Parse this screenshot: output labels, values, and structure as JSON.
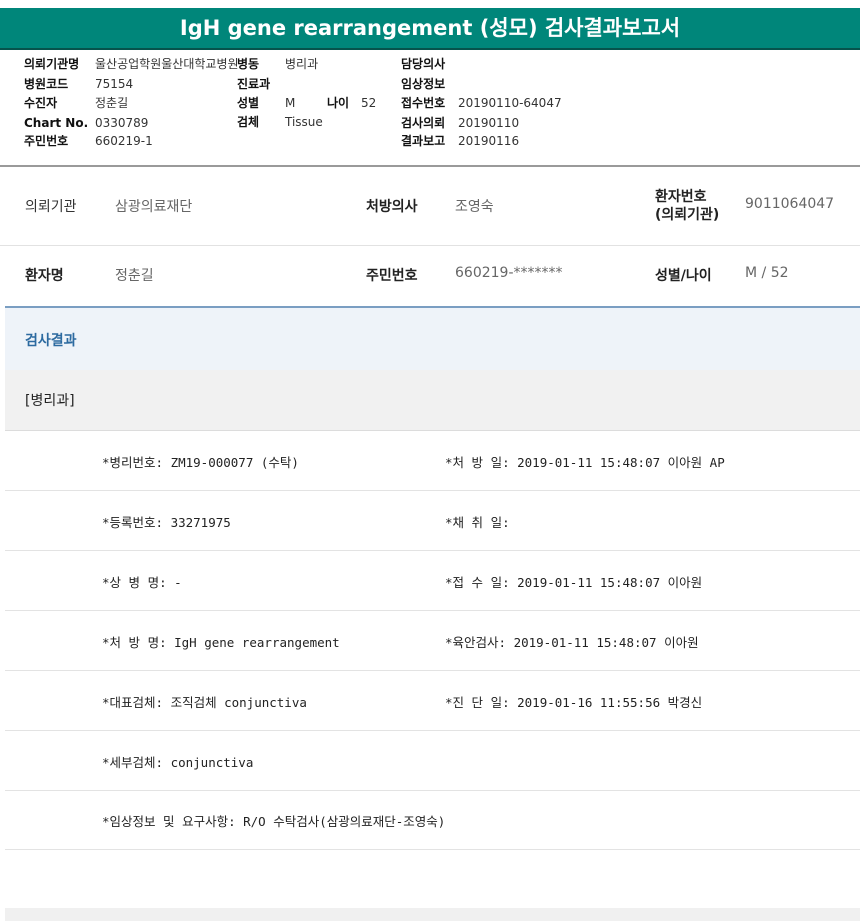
{
  "title": "IgH gene rearrangement (성모) 검사결과보고서",
  "header": {
    "col1": [
      {
        "label": "의뢰기관명",
        "value": "울산공업학원울산대학교병원"
      },
      {
        "label": "병원코드",
        "value": "75154"
      },
      {
        "label": "수진자",
        "value": "정춘길"
      },
      {
        "label": "Chart No.",
        "value": "0330789"
      },
      {
        "label": "주민번호",
        "value": "660219-1"
      }
    ],
    "col2": [
      {
        "label": "병동",
        "value": "병리과"
      },
      {
        "label": "진료과",
        "value": ""
      },
      {
        "label": "성별",
        "value": "M",
        "label2": "나이",
        "value2": "52"
      },
      {
        "label": "검체",
        "value": "Tissue"
      }
    ],
    "col3": [
      {
        "label": "담당의사",
        "value": ""
      },
      {
        "label": "임상정보",
        "value": ""
      },
      {
        "label": "접수번호",
        "value": "20190110-64047"
      },
      {
        "label": "검사의뢰",
        "value": "20190110"
      },
      {
        "label": "결과보고",
        "value": "20190116"
      }
    ]
  },
  "info": {
    "row1": {
      "org_label": "의뢰기관",
      "org_value": "삼광의료재단",
      "doctor_label": "처방의사",
      "doctor_value": "조영숙",
      "pid_label_1": "환자번호",
      "pid_label_2": "(의뢰기관)",
      "pid_value": "9011064047"
    },
    "row2": {
      "name_label": "환자명",
      "name_value": "정춘길",
      "ssn_label": "주민번호",
      "ssn_value": "660219-*******",
      "sexage_label": "성별/나이",
      "sexage_value": "M / 52"
    }
  },
  "section_title": "검사결과",
  "department": "[병리과]",
  "results": [
    {
      "left": "*병리번호: ZM19-000077 (수탁)",
      "right": "*처 방 일: 2019-01-11 15:48:07  이아원 AP"
    },
    {
      "left": "*등록번호: 33271975",
      "right": "*채 취 일:"
    },
    {
      "left": "*상 병 명: -",
      "right": "*접 수 일: 2019-01-11 15:48:07  이아원"
    },
    {
      "left": "*처 방 명: IgH gene rearrangement",
      "right": "*육안검사: 2019-01-11 15:48:07  이아원"
    },
    {
      "left": "*대표검체: 조직검체 conjunctiva",
      "right": "*진 단 일: 2019-01-16 11:55:56  박경신"
    },
    {
      "left": "*세부검체: conjunctiva",
      "right": ""
    },
    {
      "left": "*임상정보 및 요구사항: R/O 수탁검사(삼광의료재단-조영숙)",
      "right": ""
    }
  ]
}
